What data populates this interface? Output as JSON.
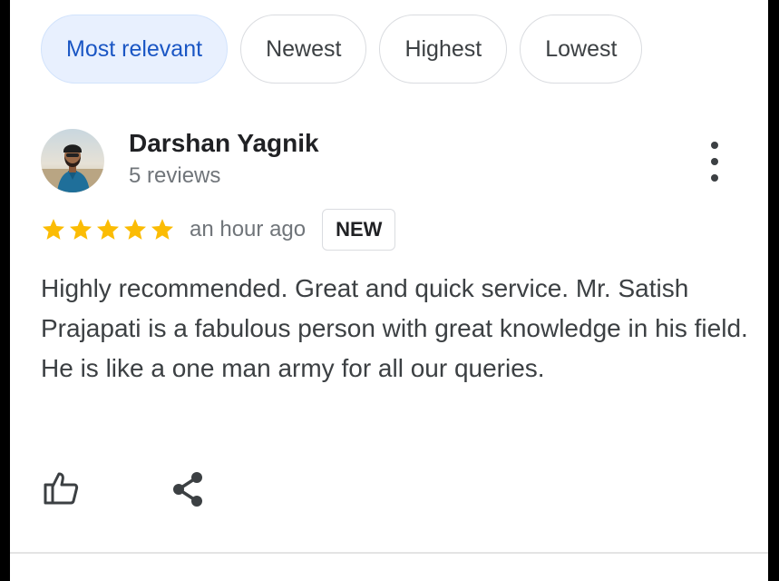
{
  "filters": {
    "chips": [
      {
        "label": "Most relevant",
        "active": true
      },
      {
        "label": "Newest",
        "active": false
      },
      {
        "label": "Highest",
        "active": false
      },
      {
        "label": "Lowest",
        "active": false
      }
    ]
  },
  "review": {
    "reviewer_name": "Darshan Yagnik",
    "reviewer_count": "5 reviews",
    "rating": 5,
    "rating_max": 5,
    "time": "an hour ago",
    "badge": "NEW",
    "text": "Highly recommended. Great and quick service. Mr. Satish Prajapati is a fabulous person with great knowledge in his field. He is like a one man army for all our queries.",
    "actions": {
      "like_icon": "thumbs-up-icon",
      "share_icon": "share-icon"
    },
    "menu_icon": "more-vert-icon"
  },
  "colors": {
    "active_chip_bg": "#e8f0fe",
    "active_chip_text": "#1a56c4",
    "star": "#fbbc04",
    "muted_text": "#70757a"
  }
}
